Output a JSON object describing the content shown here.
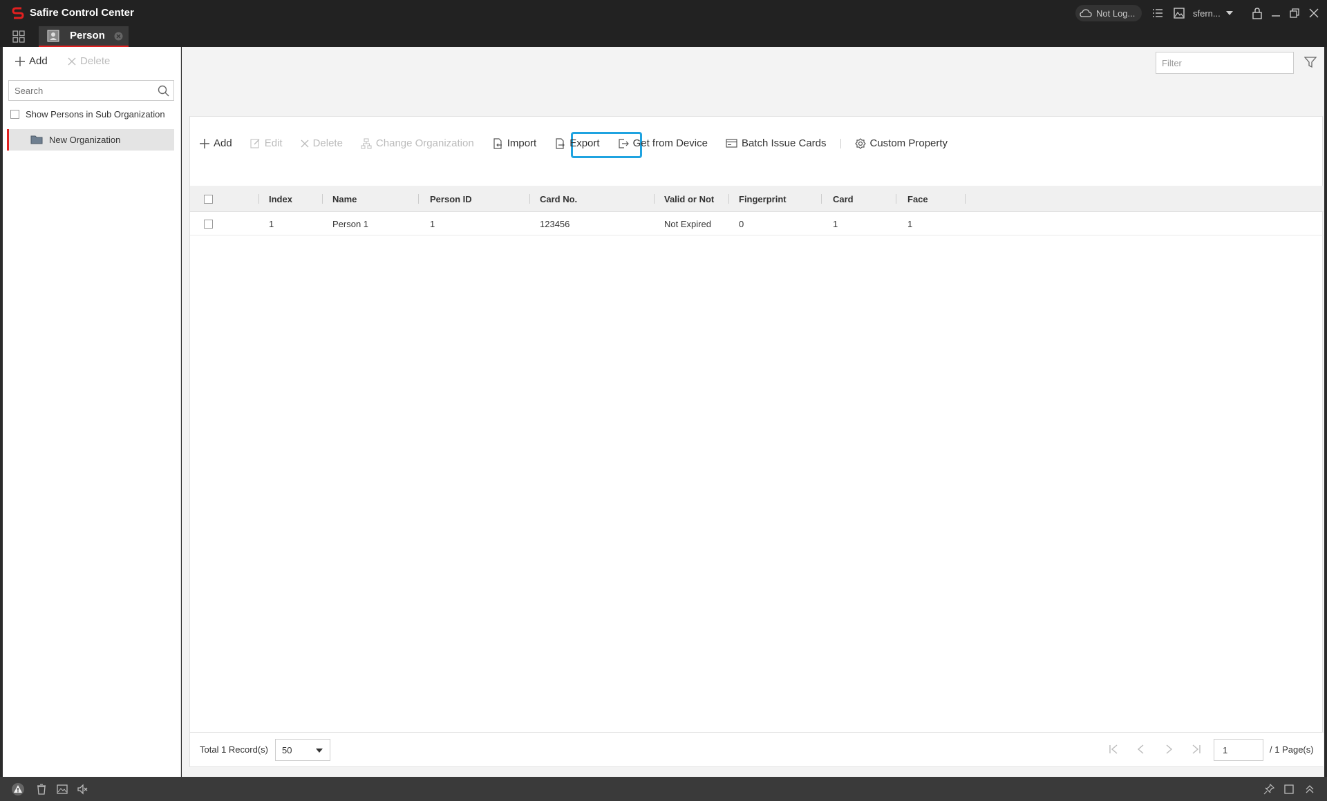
{
  "window": {
    "title": "Safire Control Center",
    "cloud_status": "Not Log...",
    "user": "sfern..."
  },
  "tabs": [
    {
      "label": "Person"
    }
  ],
  "left": {
    "add_label": "Add",
    "delete_label": "Delete",
    "search_placeholder": "Search",
    "show_sub_label": "Show Persons in Sub Organization",
    "org_name": "New Organization"
  },
  "main": {
    "filter_placeholder": "Filter",
    "toolbar": {
      "add": "Add",
      "edit": "Edit",
      "delete": "Delete",
      "change_org": "Change Organization",
      "import": "Import",
      "export": "Export",
      "get_from_device": "Get from Device",
      "batch_issue": "Batch Issue Cards",
      "custom_property": "Custom Property"
    },
    "columns": [
      "Index",
      "Name",
      "Person ID",
      "Card No.",
      "Valid or Not",
      "Fingerprint",
      "Card",
      "Face"
    ],
    "rows": [
      {
        "index": "1",
        "name": "Person 1",
        "person_id": "1",
        "card_no": "123456",
        "valid": "Not Expired",
        "fingerprint": "0",
        "card": "1",
        "face": "1"
      }
    ],
    "footer": {
      "total": "Total 1 Record(s)",
      "page_size": "50",
      "page": "1",
      "pages": "/ 1 Page(s)"
    }
  },
  "colors": {
    "accent": "#e02020",
    "highlight": "#1fa3e0"
  }
}
